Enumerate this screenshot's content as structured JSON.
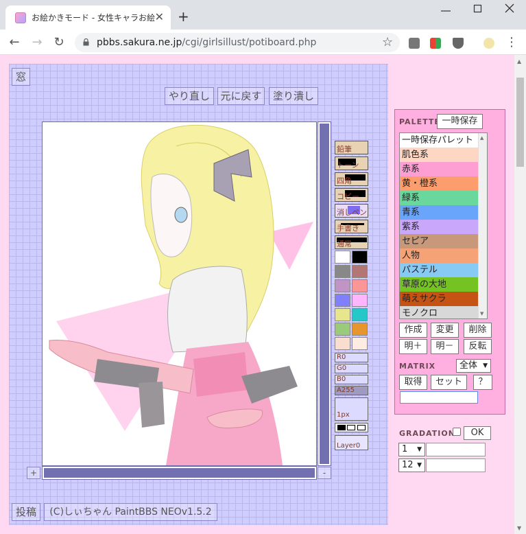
{
  "browser": {
    "tab_title": "お絵かきモード - 女性キャラお絵かき掲",
    "tab_close": "✕",
    "new_tab": "+",
    "url_host": "pbbs.sakura.ne.jp",
    "url_path": "/cgi/girlsillust/potiboard.php",
    "back": "←",
    "forward": "→",
    "reload": "↻",
    "star": "☆",
    "menu": "⋮"
  },
  "paint": {
    "window_btn": "窓",
    "redo": "やり直し",
    "undo": "元に戻す",
    "fill": "塗り潰し",
    "zoom_plus": "+",
    "zoom_minus": "-",
    "post": "投稿",
    "credit": "(C)しぃちゃん PaintBBS NEOv1.5.2",
    "tools": [
      {
        "label": "鉛筆"
      },
      {
        "label": "トーン"
      },
      {
        "label": "四角"
      },
      {
        "label": "コピー"
      },
      {
        "label": "消しペン"
      },
      {
        "label": "手書き"
      },
      {
        "label": "通常"
      }
    ],
    "swatches": [
      [
        "#ffffff",
        "#000000"
      ],
      [
        "#888888",
        "#b47575"
      ],
      [
        "#c095c6",
        "#fa9696"
      ],
      [
        "#8080ff",
        "#ffb6ff"
      ],
      [
        "#e7e58d",
        "#25c7c9"
      ],
      [
        "#99cb7b",
        "#e7962d"
      ],
      [
        "#f9ddcf",
        "#fcece2"
      ]
    ],
    "r": "R0",
    "g": "G0",
    "b": "B0",
    "a": "A255",
    "size": "1px",
    "layer": "Layer0"
  },
  "palette": {
    "heading": "PALETTE",
    "temp_save": "一時保存",
    "items": [
      {
        "label": "一時保存パレット",
        "color": "#ffffff"
      },
      {
        "label": "肌色系",
        "color": "#fdd6c4"
      },
      {
        "label": "赤系",
        "color": "#fd9fd2"
      },
      {
        "label": "黄・橙系",
        "color": "#fb9d6c"
      },
      {
        "label": "緑系",
        "color": "#6ad79c"
      },
      {
        "label": "青系",
        "color": "#6aa5fc"
      },
      {
        "label": "紫系",
        "color": "#c9a8fb"
      },
      {
        "label": "セピア",
        "color": "#c8987a"
      },
      {
        "label": "人物",
        "color": "#f6a277"
      },
      {
        "label": "パステル",
        "color": "#87cbf5"
      },
      {
        "label": "草原の大地",
        "color": "#75c322"
      },
      {
        "label": "萌えサクラ",
        "color": "#c55314"
      },
      {
        "label": "モノクロ",
        "color": "#d8d8d8"
      }
    ],
    "btn_create": "作成",
    "btn_change": "変更",
    "btn_delete": "削除",
    "btn_bright_plus": "明＋",
    "btn_bright_minus": "明－",
    "btn_invert": "反転",
    "matrix_heading": "MATRIX",
    "matrix_select": "全体",
    "btn_get": "取得",
    "btn_set": "セット",
    "btn_help": "？",
    "gradation_heading": "GRADATION",
    "btn_ok": "OK",
    "grad_select1": "1",
    "grad_select2": "12"
  }
}
